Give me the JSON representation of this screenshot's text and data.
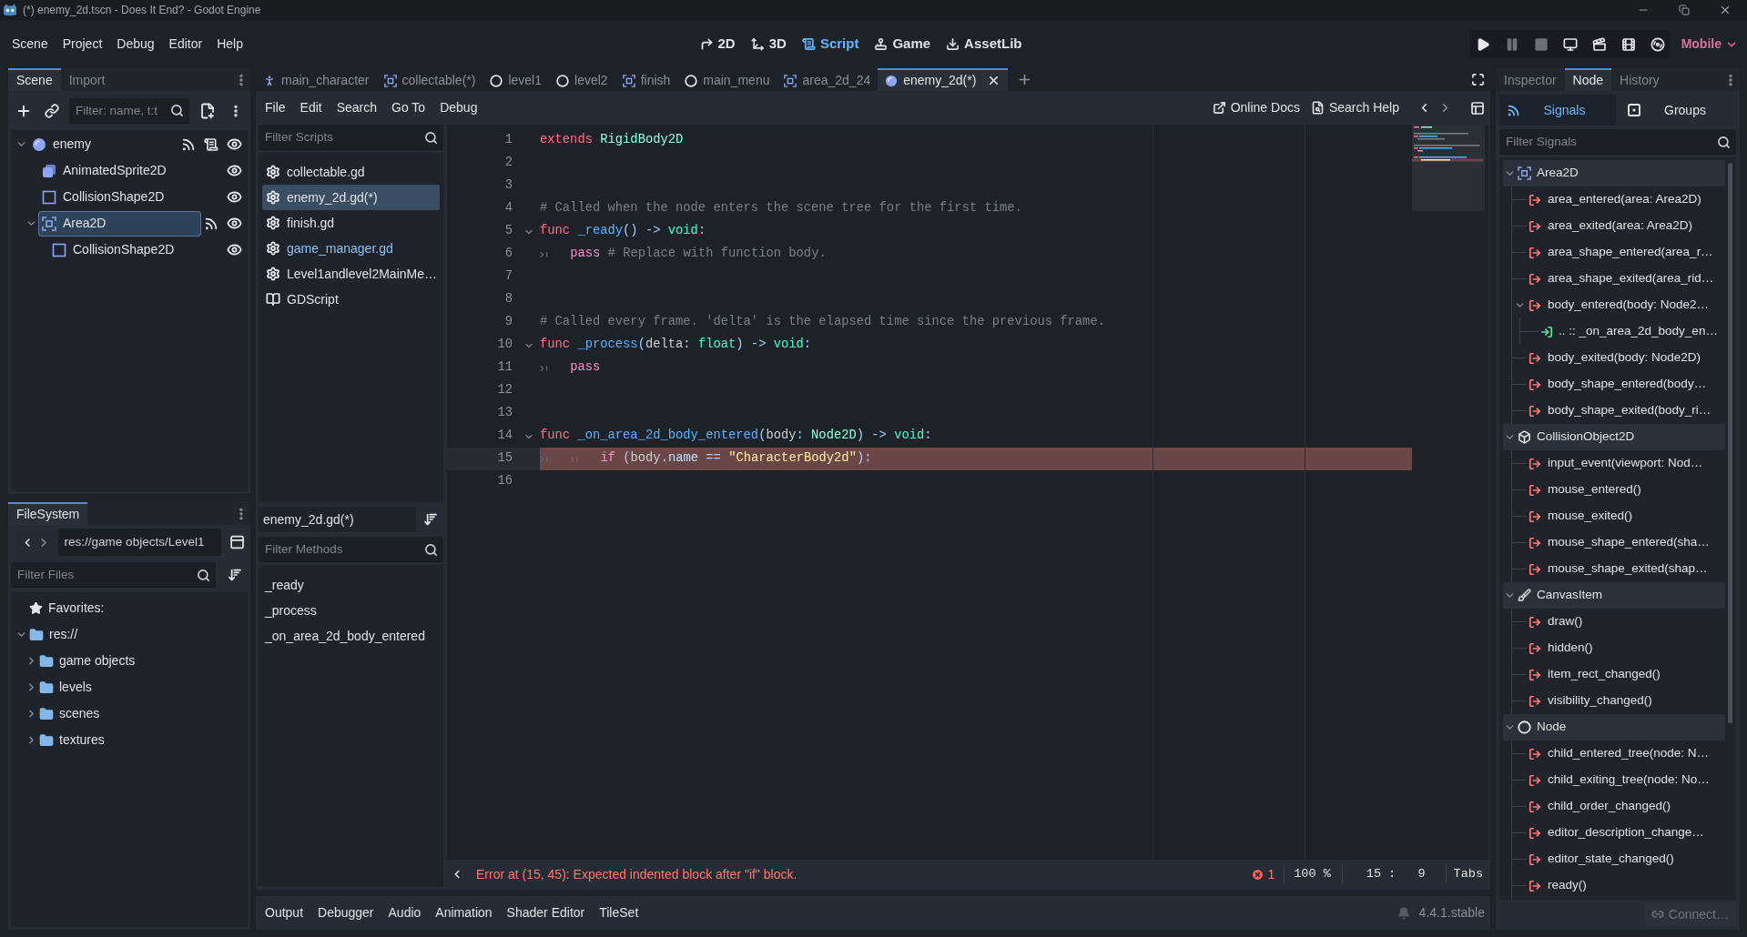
{
  "window": {
    "title": "(*) enemy_2d.tscn - Does It End? - Godot Engine"
  },
  "menu": [
    "Scene",
    "Project",
    "Debug",
    "Editor",
    "Help"
  ],
  "workspaces": [
    {
      "label": "2D",
      "kind": "canvas",
      "selected": false
    },
    {
      "label": "3D",
      "kind": "spatial",
      "selected": false
    },
    {
      "label": "Script",
      "kind": "script",
      "selected": true
    },
    {
      "label": "Game",
      "kind": "game",
      "selected": false
    },
    {
      "label": "AssetLib",
      "kind": "assetlib",
      "selected": false
    }
  ],
  "run_bar": {
    "buttons": [
      {
        "kind": "play",
        "disabled": false
      },
      {
        "kind": "pause",
        "disabled": true
      },
      {
        "kind": "stop",
        "disabled": true
      },
      {
        "kind": "remote",
        "disabled": false
      },
      {
        "kind": "scene",
        "disabled": false
      },
      {
        "kind": "custom",
        "disabled": false
      },
      {
        "kind": "movie",
        "disabled": false
      }
    ],
    "renderer": "Mobile"
  },
  "scene_dock": {
    "tabs": [
      {
        "label": "Scene",
        "selected": true
      },
      {
        "label": "Import",
        "selected": false
      }
    ],
    "filter": {
      "placeholder": "Filter: name, t:t"
    },
    "tree": [
      {
        "label": "enemy",
        "kind": "rigidbody",
        "selected": false,
        "expanded": true,
        "signals": true,
        "script": true,
        "visible": true,
        "children": [
          {
            "label": "AnimatedSprite2D",
            "kind": "sprite",
            "selected": false,
            "signals": false,
            "script": false,
            "visible": true
          },
          {
            "label": "CollisionShape2D",
            "kind": "shape",
            "selected": false,
            "signals": false,
            "script": false,
            "visible": true
          },
          {
            "label": "Area2D",
            "kind": "area",
            "selected": true,
            "expanded": true,
            "signals": true,
            "script": false,
            "visible": true,
            "children": [
              {
                "label": "CollisionShape2D",
                "kind": "shape",
                "selected": false,
                "signals": false,
                "script": false,
                "visible": true
              }
            ]
          }
        ]
      }
    ]
  },
  "filesystem_dock": {
    "tabs": [
      {
        "label": "FileSystem",
        "selected": true
      }
    ],
    "path": "res://game objects/Level1",
    "filter": {
      "placeholder": "Filter Files"
    },
    "favorites": "Favorites:",
    "tree": [
      {
        "label": "res://",
        "expanded": true,
        "children": [
          {
            "label": "game objects",
            "expanded": false
          },
          {
            "label": "levels",
            "expanded": false
          },
          {
            "label": "scenes",
            "expanded": false
          },
          {
            "label": "textures",
            "expanded": false
          }
        ]
      }
    ]
  },
  "scene_tabs": [
    {
      "label": "main_character",
      "kind": "character",
      "selected": false
    },
    {
      "label": "collectable(*)",
      "kind": "area",
      "selected": false
    },
    {
      "label": "level1",
      "kind": "node",
      "selected": false
    },
    {
      "label": "level2",
      "kind": "node",
      "selected": false
    },
    {
      "label": "finish",
      "kind": "area",
      "selected": false
    },
    {
      "label": "main_menu",
      "kind": "node",
      "selected": false
    },
    {
      "label": "area_2d_24",
      "kind": "area",
      "selected": false
    },
    {
      "label": "enemy_2d(*)",
      "kind": "rigidbody",
      "selected": true
    }
  ],
  "script_editor": {
    "menu": [
      "File",
      "Edit",
      "Search",
      "Go To",
      "Debug"
    ],
    "help_links": [
      {
        "label": "Online Docs",
        "kind": "external"
      },
      {
        "label": "Search Help",
        "kind": "help"
      }
    ],
    "script_filter": {
      "placeholder": "Filter Scripts"
    },
    "scripts": [
      {
        "label": "collectable.gd",
        "kind": "gdscript",
        "selected": false,
        "highlighted": false
      },
      {
        "label": "enemy_2d.gd(*)",
        "kind": "gdscript",
        "selected": true,
        "highlighted": false
      },
      {
        "label": "finish.gd",
        "kind": "gdscript",
        "selected": false,
        "highlighted": false
      },
      {
        "label": "game_manager.gd",
        "kind": "gdscript",
        "selected": false,
        "highlighted": true
      },
      {
        "label": "Level1andlevel2MainMe…",
        "kind": "gdscript",
        "selected": false,
        "highlighted": false
      },
      {
        "label": "GDScript",
        "kind": "doc",
        "selected": false,
        "highlighted": false
      }
    ],
    "current_script": "enemy_2d.gd(*)",
    "method_filter": {
      "placeholder": "Filter Methods"
    },
    "methods": [
      "_ready",
      "_process",
      "_on_area_2d_body_entered"
    ],
    "code": [
      {
        "number": "1",
        "foldable": false,
        "current": false,
        "error": false,
        "tokens": [
          {
            "text": "extends ",
            "kind": "keyword"
          },
          {
            "text": "RigidBody2D",
            "kind": "engine_type"
          }
        ]
      },
      {
        "number": "2",
        "foldable": false,
        "current": false,
        "error": false
      },
      {
        "number": "3",
        "foldable": false,
        "current": false,
        "error": false
      },
      {
        "number": "4",
        "foldable": false,
        "current": false,
        "error": false,
        "tokens": [
          {
            "text": "# Called when the node enters the scene tree for the first time.",
            "kind": "comment"
          }
        ]
      },
      {
        "number": "5",
        "foldable": true,
        "current": false,
        "error": false,
        "tokens": [
          {
            "text": "func ",
            "kind": "keyword"
          },
          {
            "text": "_ready",
            "kind": "function"
          },
          {
            "text": "() -> ",
            "kind": "symbol"
          },
          {
            "text": "void",
            "kind": "base_type"
          },
          {
            "text": ":",
            "kind": "symbol"
          }
        ]
      },
      {
        "number": "6",
        "foldable": false,
        "current": false,
        "error": false,
        "tokens": [
          {
            "kind": "tab"
          },
          {
            "text": "pass",
            "kind": "control"
          },
          {
            "text": " # Replace with function body.",
            "kind": "comment"
          }
        ]
      },
      {
        "number": "7",
        "foldable": false,
        "current": false,
        "error": false
      },
      {
        "number": "8",
        "foldable": false,
        "current": false,
        "error": false
      },
      {
        "number": "9",
        "foldable": false,
        "current": false,
        "error": false,
        "tokens": [
          {
            "text": "# Called every frame. 'delta' is the elapsed time since the previous frame.",
            "kind": "comment"
          }
        ]
      },
      {
        "number": "10",
        "foldable": true,
        "current": false,
        "error": false,
        "tokens": [
          {
            "text": "func ",
            "kind": "keyword"
          },
          {
            "text": "_process",
            "kind": "function"
          },
          {
            "text": "(",
            "kind": "symbol"
          },
          {
            "text": "delta",
            "kind": "plain"
          },
          {
            "text": ": ",
            "kind": "symbol"
          },
          {
            "text": "float",
            "kind": "base_type"
          },
          {
            "text": ") -> ",
            "kind": "symbol"
          },
          {
            "text": "void",
            "kind": "base_type"
          },
          {
            "text": ":",
            "kind": "symbol"
          }
        ]
      },
      {
        "number": "11",
        "foldable": false,
        "current": false,
        "error": false,
        "tokens": [
          {
            "kind": "tab"
          },
          {
            "text": "pass",
            "kind": "control"
          }
        ]
      },
      {
        "number": "12",
        "foldable": false,
        "current": false,
        "error": false
      },
      {
        "number": "13",
        "foldable": false,
        "current": false,
        "error": false
      },
      {
        "number": "14",
        "foldable": true,
        "current": false,
        "error": false,
        "tokens": [
          {
            "text": "func ",
            "kind": "keyword"
          },
          {
            "text": "_on_area_2d_body_entered",
            "kind": "function"
          },
          {
            "text": "(",
            "kind": "symbol"
          },
          {
            "text": "body",
            "kind": "plain"
          },
          {
            "text": ": ",
            "kind": "symbol"
          },
          {
            "text": "Node2D",
            "kind": "engine_type"
          },
          {
            "text": ") -> ",
            "kind": "symbol"
          },
          {
            "text": "void",
            "kind": "base_type"
          },
          {
            "text": ":",
            "kind": "symbol"
          }
        ]
      },
      {
        "number": "15",
        "foldable": false,
        "current": true,
        "error": true,
        "tokens": [
          {
            "kind": "tab"
          },
          {
            "kind": "tab"
          },
          {
            "text": "if",
            "kind": "control"
          },
          {
            "text": " (",
            "kind": "symbol"
          },
          {
            "text": "body",
            "kind": "plain"
          },
          {
            "text": ".",
            "kind": "symbol"
          },
          {
            "text": "name",
            "kind": "member"
          },
          {
            "text": " == ",
            "kind": "symbol"
          },
          {
            "text": "\"CharacterBody2d\"",
            "kind": "string"
          },
          {
            "text": "):",
            "kind": "symbol"
          }
        ]
      },
      {
        "number": "16",
        "foldable": false,
        "current": false,
        "error": false
      }
    ],
    "status": {
      "message": "Error at (15, 45): Expected indented block after \"if\" block.",
      "error_count": "1",
      "zoom": "100 %",
      "position": "15 :   9",
      "indentation": "Tabs"
    }
  },
  "bottom_panel": {
    "tabs": [
      {
        "label": "Output",
        "selected": false
      },
      {
        "label": "Debugger",
        "selected": false
      },
      {
        "label": "Audio",
        "selected": false
      },
      {
        "label": "Animation",
        "selected": false
      },
      {
        "label": "Shader Editor",
        "selected": false
      },
      {
        "label": "TileSet",
        "selected": false
      }
    ],
    "version": "4.4.1.stable"
  },
  "node_dock": {
    "tabs": [
      {
        "label": "Inspector",
        "selected": false
      },
      {
        "label": "Node",
        "selected": true
      },
      {
        "label": "History",
        "selected": false
      }
    ],
    "subtabs": [
      {
        "label": "Signals",
        "kind": "signals",
        "selected": true
      },
      {
        "label": "Groups",
        "kind": "groups",
        "selected": false
      }
    ],
    "filter": {
      "placeholder": "Filter Signals"
    },
    "classes": [
      {
        "label": "Area2D",
        "kind": "area",
        "expanded": true,
        "signals": [
          {
            "label": "area_entered(area: Area2D)"
          },
          {
            "label": "area_exited(area: Area2D)"
          },
          {
            "label": "area_shape_entered(area_r…"
          },
          {
            "label": "area_shape_exited(area_rid…"
          },
          {
            "label": "body_entered(body: Node2…",
            "expanded": true,
            "connections": [
              {
                "label": ".. :: _on_area_2d_body_en…"
              }
            ]
          },
          {
            "label": "body_exited(body: Node2D)"
          },
          {
            "label": "body_shape_entered(body…"
          },
          {
            "label": "body_shape_exited(body_ri…"
          }
        ]
      },
      {
        "label": "CollisionObject2D",
        "kind": "cube",
        "expanded": true,
        "signals": [
          {
            "label": "input_event(viewport: Nod…"
          },
          {
            "label": "mouse_entered()"
          },
          {
            "label": "mouse_exited()"
          },
          {
            "label": "mouse_shape_entered(sha…"
          },
          {
            "label": "mouse_shape_exited(shap…"
          }
        ]
      },
      {
        "label": "CanvasItem",
        "kind": "brush",
        "expanded": true,
        "signals": [
          {
            "label": "draw()"
          },
          {
            "label": "hidden()"
          },
          {
            "label": "item_rect_changed()"
          },
          {
            "label": "visibility_changed()"
          }
        ]
      },
      {
        "label": "Node",
        "kind": "node",
        "expanded": true,
        "signals": [
          {
            "label": "child_entered_tree(node: N…"
          },
          {
            "label": "child_exiting_tree(node: No…"
          },
          {
            "label": "child_order_changed()"
          },
          {
            "label": "editor_description_change…"
          },
          {
            "label": "editor_state_changed()"
          },
          {
            "label": "ready()"
          }
        ]
      }
    ],
    "connect_button": {
      "label": "Connect…",
      "disabled": true
    }
  }
}
